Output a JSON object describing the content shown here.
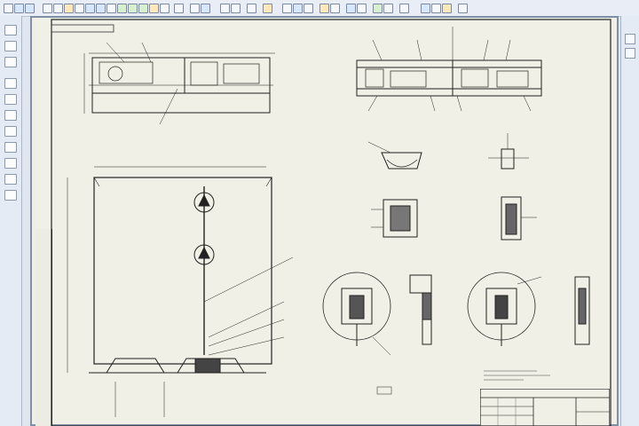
{
  "app": {
    "toolbar_icons": [
      "new-file-icon",
      "open-icon",
      "save-icon",
      "print-icon",
      "cut-icon",
      "copy-icon",
      "paste-icon",
      "undo-icon",
      "redo-icon",
      "select-icon",
      "line-icon",
      "circle-icon",
      "arc-icon",
      "rectangle-icon",
      "hatch-icon",
      "dimension-icon",
      "text-icon",
      "layer-icon",
      "zoom-in-icon",
      "zoom-out-icon",
      "pan-icon",
      "measure-icon",
      "grid-icon",
      "snap-icon",
      "ortho-icon",
      "help-icon"
    ],
    "left_panel_icons": [
      "select-tool-icon",
      "point-icon",
      "line-tool-icon",
      "polyline-icon",
      "circle-tool-icon",
      "arc-tool-icon",
      "spline-icon",
      "hatch-tool-icon",
      "dimension-tool-icon",
      "text-tool-icon",
      "table-icon",
      "layers-icon",
      "properties-icon",
      "library-icon"
    ],
    "right_panel_icons": [
      "zoom-fit-icon",
      "zoom-window-icon"
    ]
  },
  "drawing": {
    "sheet": "technical-drawing-sheet",
    "colors": {
      "paper": "#f0f0e6",
      "ink": "#222222",
      "frame": "#7f8fa6",
      "ui": "#e5ebf4"
    }
  }
}
